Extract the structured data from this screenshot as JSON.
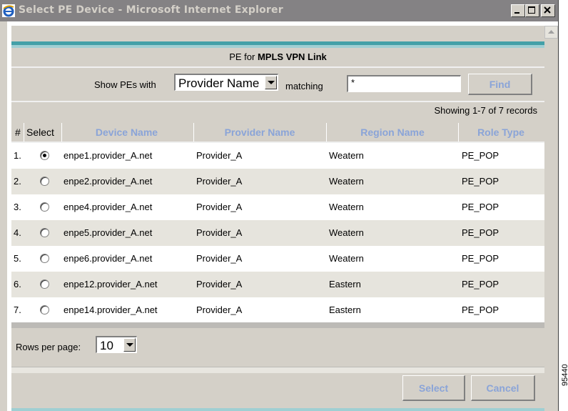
{
  "window": {
    "title": "Select PE Device - Microsoft Internet Explorer",
    "controls": [
      "minimize",
      "maximize",
      "close"
    ]
  },
  "header": {
    "prefix": "PE for",
    "subject": "MPLS VPN Link"
  },
  "filter": {
    "label": "Show PEs with",
    "field_value": "Provider Name",
    "matching_label": "matching",
    "match_value": "*",
    "find_label": "Find"
  },
  "records_text": "Showing 1-7 of 7 records",
  "table": {
    "columns": [
      "#",
      "Select",
      "Device Name",
      "Provider Name",
      "Region Name",
      "Role Type"
    ],
    "rows": [
      {
        "num": "1.",
        "selected": true,
        "device": "enpe1.provider_A.net",
        "provider": "Provider_A",
        "region": "Weatern",
        "role": "PE_POP"
      },
      {
        "num": "2.",
        "selected": false,
        "device": "enpe2.provider_A.net",
        "provider": "Provider_A",
        "region": "Weatern",
        "role": "PE_POP"
      },
      {
        "num": "3.",
        "selected": false,
        "device": "enpe4.provider_A.net",
        "provider": "Provider_A",
        "region": "Weatern",
        "role": "PE_POP"
      },
      {
        "num": "4.",
        "selected": false,
        "device": "enpe5.provider_A.net",
        "provider": "Provider_A",
        "region": "Weatern",
        "role": "PE_POP"
      },
      {
        "num": "5.",
        "selected": false,
        "device": "enpe6.provider_A.net",
        "provider": "Provider_A",
        "region": "Weatern",
        "role": "PE_POP"
      },
      {
        "num": "6.",
        "selected": false,
        "device": "enpe12.provider_A.net",
        "provider": "Provider_A",
        "region": "Eastern",
        "role": "PE_POP"
      },
      {
        "num": "7.",
        "selected": false,
        "device": "enpe14.provider_A.net",
        "provider": "Provider_A",
        "region": "Eastern",
        "role": "PE_POP"
      }
    ]
  },
  "pagination": {
    "rows_label": "Rows per page:",
    "rows_value": "10"
  },
  "actions": {
    "select_label": "Select",
    "cancel_label": "Cancel"
  },
  "figure_id": "95440",
  "colors": {
    "accent_teal": "#43a0a8",
    "link_blue": "#8aa4d8",
    "panel_gray": "#d4d0c8"
  }
}
